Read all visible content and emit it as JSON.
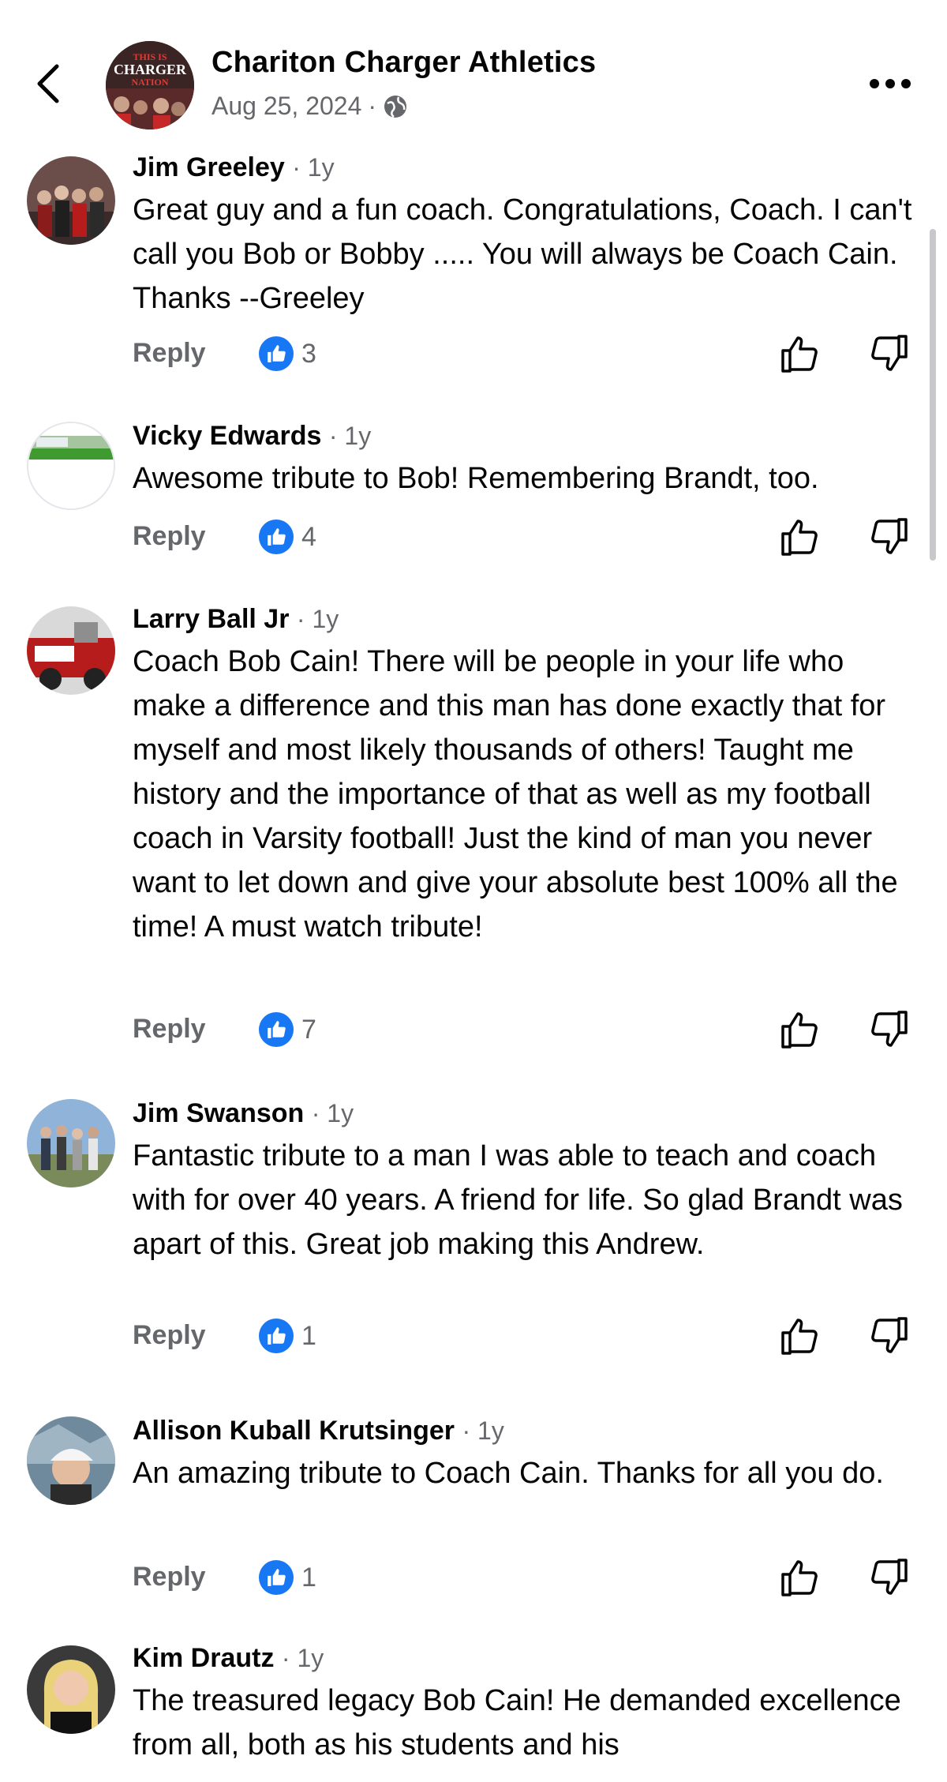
{
  "header": {
    "page_name": "Chariton Charger Athletics",
    "date": "Aug 25, 2024",
    "separator": "·",
    "privacy_icon": "globe-icon",
    "avatar_text": [
      "THIS IS",
      "CHARGER",
      "NATION"
    ]
  },
  "comments": [
    {
      "author": "Jim Greeley",
      "time": "· 1y",
      "text": "Great guy and a fun coach.  Congratulations, Coach.  I can't call you Bob or Bobby ..... You will always be Coach Cain.  Thanks --Greeley",
      "reply_label": "Reply",
      "like_count": "3"
    },
    {
      "author": "Vicky Edwards",
      "time": "· 1y",
      "text": "Awesome tribute to Bob! Remembering Brandt, too.",
      "reply_label": "Reply",
      "like_count": "4"
    },
    {
      "author": "Larry Ball Jr",
      "time": "· 1y",
      "text": "Coach Bob Cain! There will be people in your life who make a difference and this man has done exactly that for myself and most likely thousands of others! Taught me history and the importance of that as well as my football coach in Varsity football! Just the kind of man you never want to let down and give your absolute best 100% all the time! A must watch tribute!",
      "reply_label": "Reply",
      "like_count": "7"
    },
    {
      "author": "Jim Swanson",
      "time": "· 1y",
      "text": "Fantastic tribute to a man I was able to teach and coach with for over 40 years. A friend for life. So glad Brandt was apart of this. Great job making this Andrew.",
      "reply_label": "Reply",
      "like_count": "1"
    },
    {
      "author": "Allison Kuball Krutsinger",
      "time": "· 1y",
      "text": "An amazing tribute to Coach Cain. Thanks for all you do.",
      "reply_label": "Reply",
      "like_count": "1"
    },
    {
      "author": "Kim Drautz",
      "time": "· 1y",
      "text": "The treasured legacy Bob Cain!  He demanded excellence from all, both as his students and his"
    }
  ],
  "colors": {
    "like_blue": "#1877f2",
    "secondary_text": "#65676b",
    "primary_text": "#050505"
  }
}
